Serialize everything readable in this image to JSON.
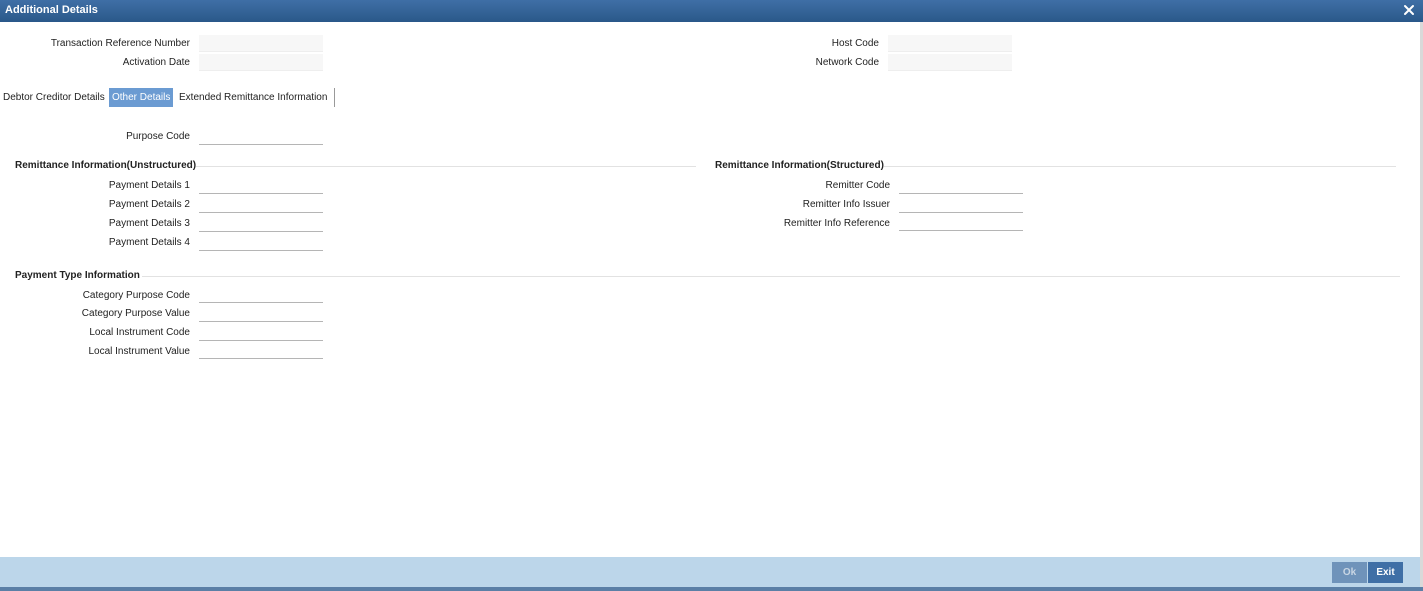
{
  "window": {
    "title": "Additional Details"
  },
  "header": {
    "transaction_reference_number": {
      "label": "Transaction Reference Number",
      "value": ""
    },
    "activation_date": {
      "label": "Activation Date",
      "value": ""
    },
    "host_code": {
      "label": "Host Code",
      "value": ""
    },
    "network_code": {
      "label": "Network Code",
      "value": ""
    }
  },
  "tabs": [
    {
      "label": "Debtor Creditor Details",
      "active": false
    },
    {
      "label": "Other Details",
      "active": true
    },
    {
      "label": "Extended Remittance Information",
      "active": false
    }
  ],
  "other_details": {
    "purpose_code": {
      "label": "Purpose Code",
      "value": ""
    },
    "remittance_unstructured": {
      "heading": "Remittance Information(Unstructured)",
      "fields": [
        {
          "label": "Payment Details 1",
          "value": ""
        },
        {
          "label": "Payment Details 2",
          "value": ""
        },
        {
          "label": "Payment Details 3",
          "value": ""
        },
        {
          "label": "Payment Details 4",
          "value": ""
        }
      ]
    },
    "remittance_structured": {
      "heading": "Remittance Information(Structured)",
      "fields": [
        {
          "label": "Remitter Code",
          "value": ""
        },
        {
          "label": "Remitter Info Issuer",
          "value": ""
        },
        {
          "label": "Remitter Info Reference",
          "value": ""
        }
      ]
    },
    "payment_type": {
      "heading": "Payment Type Information",
      "fields": [
        {
          "label": "Category Purpose Code",
          "value": ""
        },
        {
          "label": "Category Purpose Value",
          "value": ""
        },
        {
          "label": "Local Instrument Code",
          "value": ""
        },
        {
          "label": "Local Instrument Value",
          "value": ""
        }
      ]
    }
  },
  "footer": {
    "ok_label": "Ok",
    "exit_label": "Exit"
  },
  "colors": {
    "titlebar": "#2f5f95",
    "active_tab": "#6b9bd2",
    "footer": "#bcd6ea",
    "button": "#3f6fa6"
  },
  "icons": {
    "close": "close-icon"
  }
}
